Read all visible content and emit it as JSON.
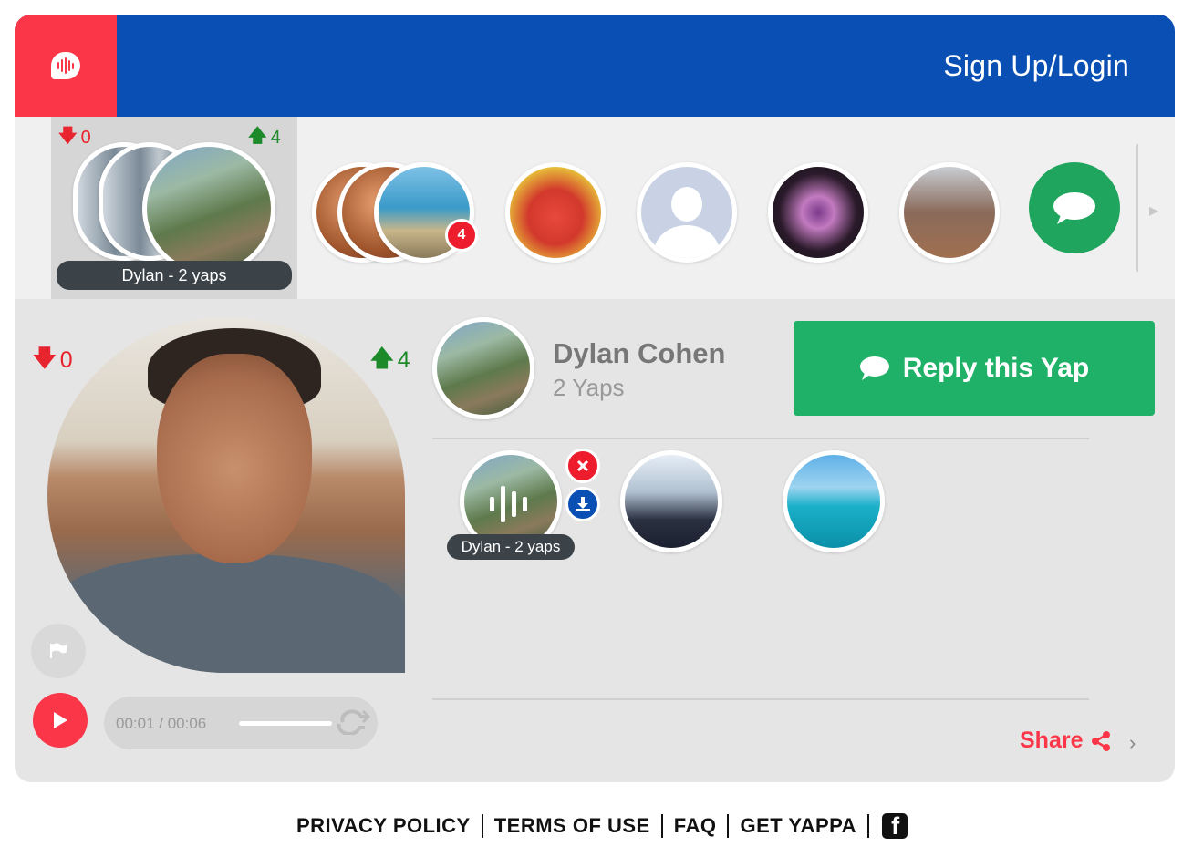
{
  "header": {
    "logo": "yappa-logo-icon",
    "signup_label": "Sign Up/Login",
    "colors": {
      "header_bg": "#0a50b4",
      "logo_bg": "#fb3648"
    }
  },
  "strip": {
    "active": {
      "downvotes": "0",
      "upvotes": "4",
      "name_label": "Dylan - 2 yaps",
      "images": [
        "bridge",
        "bridge",
        "coast"
      ]
    },
    "items": [
      {
        "image": "group-coast",
        "badge": "4"
      },
      {
        "image": "mug"
      },
      {
        "image": "default-avatar"
      },
      {
        "image": "wings"
      },
      {
        "image": "street"
      }
    ],
    "chat_icon": "speech-bubble-icon",
    "next_icon": "chevron-right-icon"
  },
  "video": {
    "downvotes": "0",
    "upvotes": "4",
    "flag_icon": "flag-icon",
    "play_icon": "play-icon",
    "time": "00:01 / 00:06",
    "progress": 0.17,
    "loop_icon": "loop-icon"
  },
  "profile": {
    "name": "Dylan Cohen",
    "yaps": "2 Yaps",
    "reply_label": "Reply this Yap",
    "reply_color": "#20b168"
  },
  "replies": [
    {
      "image": "coast",
      "name_label": "Dylan - 2 yaps",
      "playing": true,
      "actions": [
        "close-icon",
        "download-icon"
      ]
    },
    {
      "image": "suit"
    },
    {
      "image": "ocean"
    }
  ],
  "share": {
    "label": "Share",
    "color": "#fb3648"
  },
  "footer": {
    "links": [
      "PRIVACY POLICY",
      "TERMS OF USE",
      "FAQ",
      "GET YAPPA"
    ],
    "social_icon": "facebook-icon"
  }
}
